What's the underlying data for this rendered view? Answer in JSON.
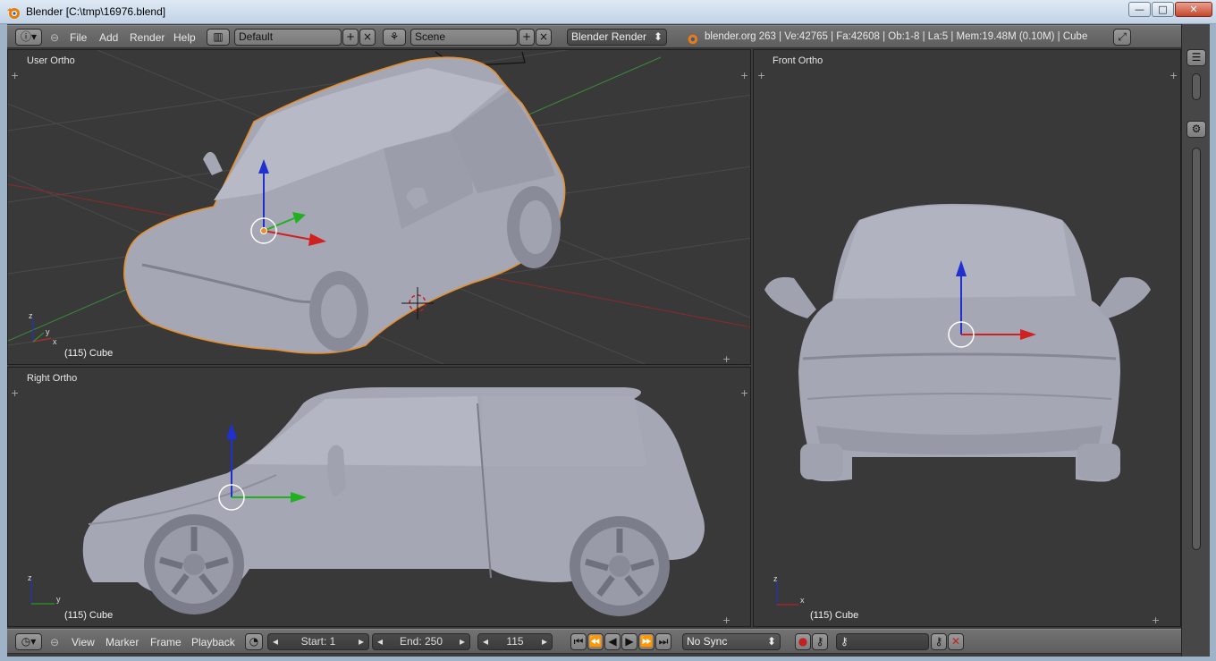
{
  "window": {
    "title": "Blender [C:\\tmp\\16976.blend]",
    "minimize": "—",
    "maximize": "□",
    "close": "✕"
  },
  "top_header": {
    "menus": [
      "File",
      "Add",
      "Render",
      "Help"
    ],
    "screen_layout": "Default",
    "scene": "Scene",
    "render_engine": "Blender Render",
    "stats": "blender.org 263 | Ve:42765 | Fa:42608 | Ob:1-8 | La:5 | Mem:19.48M (0.10M) | Cube"
  },
  "viewports": {
    "user": {
      "label": "User Ortho",
      "object": "(115) Cube"
    },
    "right": {
      "label": "Right Ortho",
      "object": "(115) Cube"
    },
    "front": {
      "label": "Front Ortho",
      "object": "(115) Cube"
    }
  },
  "timeline": {
    "menus": [
      "View",
      "Marker",
      "Frame",
      "Playback"
    ],
    "start": "Start: 1",
    "end": "End: 250",
    "current": "115",
    "sync": "No Sync"
  },
  "colors": {
    "x_axis": "#d02020",
    "y_axis": "#20b020",
    "z_axis": "#2030d0",
    "selection": "#e88f2a",
    "car": "#a6a7b4"
  }
}
